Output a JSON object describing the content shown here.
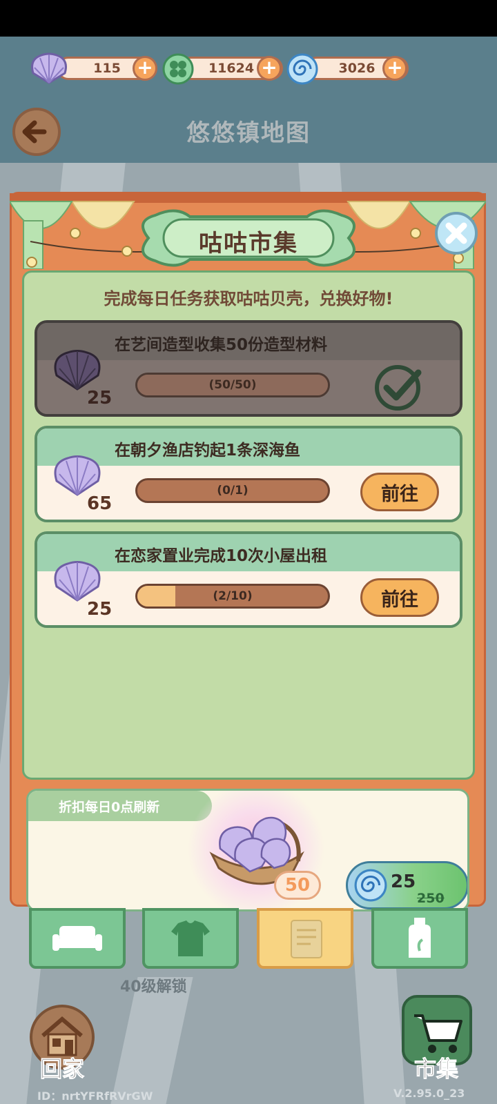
{
  "header": {
    "title": "悠悠镇地图",
    "currencies": [
      {
        "icon": "shell-icon",
        "value": "115"
      },
      {
        "icon": "clover-icon",
        "value": "11624"
      },
      {
        "icon": "swirl-icon",
        "value": "3026"
      }
    ]
  },
  "modal": {
    "title": "咕咕市集",
    "subtitle": "完成每日任务获取咕咕贝壳，兑换好物!",
    "tasks": [
      {
        "title": "在艺间造型收集50份造型材料",
        "progress_text": "(50/50)",
        "progress": 1.0,
        "reward": "25",
        "completed": true
      },
      {
        "title": "在朝夕渔店钓起1条深海鱼",
        "progress_text": "(0/1)",
        "progress": 0.0,
        "reward": "65",
        "button": "前往"
      },
      {
        "title": "在恋家置业完成10次小屋出租",
        "progress_text": "(2/10)",
        "progress": 0.2,
        "reward": "25",
        "button": "前往"
      }
    ],
    "discount": {
      "tab_label": "折扣每日0点刷新",
      "quantity": "50",
      "price": "25",
      "original_price": "250"
    }
  },
  "tabs": [
    "sofa-icon",
    "shirt-icon",
    "notebook-icon",
    "bottle-icon"
  ],
  "lock_text": "40级解锁",
  "bottom": {
    "home_label": "回家",
    "market_label": "市集",
    "user_id": "ID：nrtYFRfRVrGW",
    "version": "V.2.95.0_23"
  }
}
